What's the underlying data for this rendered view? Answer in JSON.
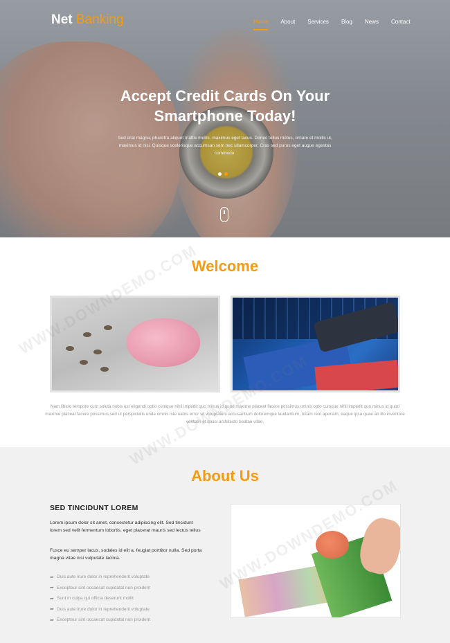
{
  "brand": {
    "part1": "Net",
    "part2": "Banking"
  },
  "menu": [
    "Home",
    "About",
    "Services",
    "Blog",
    "News",
    "Contact"
  ],
  "hero": {
    "title_line1": "Accept Credit Cards On Your",
    "title_line2": "Smartphone Today!",
    "subtitle": "Sed erat magna, pharetra aliquet mattis mollis, maximus eget lacus. Donec tellus metus, ornare et mollis ut, maximus id nisi. Quisque scelerisque accumsan sem nec ullamcorper. Cras sed purus eget augue egestas commodo.",
    "slides_active": 1
  },
  "welcome": {
    "title": "Welcome",
    "text": "Nam libero tempore cum soluta nobis est eligendi optio cumque nihil impedit quo minus id quod maxime placeat facere possimus omnis opto cumque nihil impedit quo minus id quod maxime placeat facere possimus,sed ut perspiciatis unde omnis iste natus error sit voluptatem accusantium doloremque laudantium, totam rem aperiam, eaque ipsa quae ab illo inventore veritatis et quasi architecto beatae vitae."
  },
  "about": {
    "title": "About Us",
    "heading": "SED TINCIDUNT LOREM",
    "para1": "Lorem ipsum dolor sit amet, consectetur adipiscing elit. Sed tincidunt lorem sed velit fermentum lobortis. eget placerat mauris sed lectus tellus",
    "para2": "Fusce eu semper lacus, sodales id elit a, feugiat porttitor nulla. Sed porta magna vitae nisi vulputate lacinia.",
    "list": [
      "Duis aute irure dolor in reprehenderit voluptate",
      "Excepteur sint occaecat cupidatat non proident",
      "Sunt in culpa qui officia deserunt mollit",
      "Duis aute irure dolor in reprehenderit voluptate",
      "Excepteur sint occaecat cupidatat non proident"
    ]
  },
  "watermark": "WWW.DOWNDEMO.COM",
  "colors": {
    "accent": "#f39c12",
    "about_bg": "#f1f1f1"
  }
}
